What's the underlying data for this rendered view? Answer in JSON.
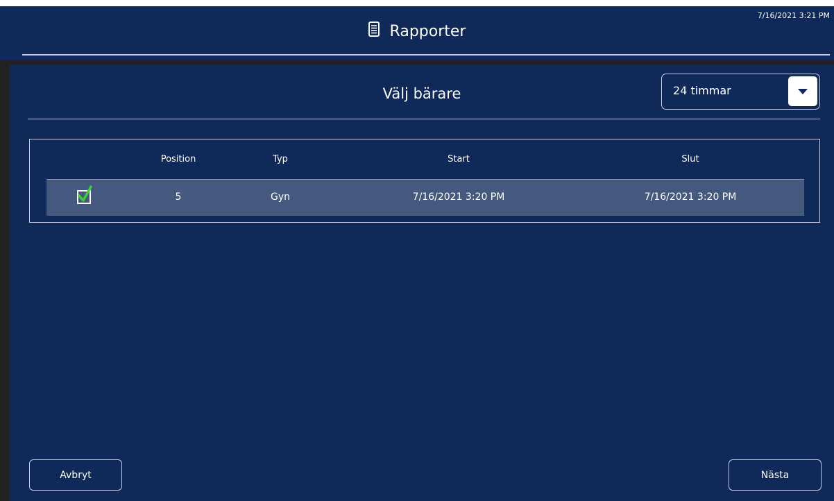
{
  "header": {
    "title": "Rapporter",
    "title_icon": "document-icon",
    "timestamp": "7/16/2021 3:21 PM"
  },
  "panel": {
    "title": "Välj bärare",
    "range_select": {
      "selected": "24 timmar",
      "icon": "caret-down-icon"
    }
  },
  "table": {
    "headers": {
      "position": "Position",
      "type": "Typ",
      "start": "Start",
      "end": "Slut"
    },
    "rows": [
      {
        "checked": true,
        "position": "5",
        "type": "Gyn",
        "start": "7/16/2021 3:20 PM",
        "end": "7/16/2021 3:20 PM"
      }
    ]
  },
  "footer": {
    "cancel_label": "Avbryt",
    "next_label": "Nästa"
  },
  "colors": {
    "background": "#0f2a5a",
    "selected_row": "#44597d",
    "check_green": "#3ecb3e",
    "border": "#c8ccd6"
  }
}
